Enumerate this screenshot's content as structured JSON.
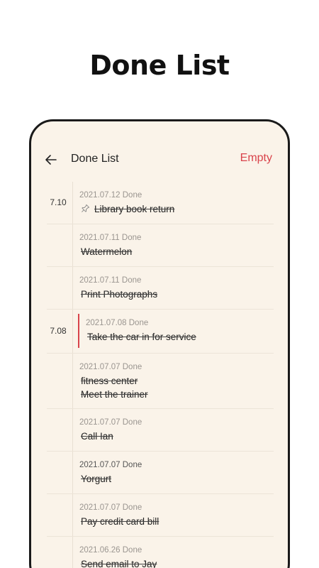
{
  "hero": {
    "title": "Done List"
  },
  "header": {
    "title": "Done List",
    "empty_label": "Empty"
  },
  "groups": [
    {
      "date": "7.10"
    },
    {
      "date": "7.08"
    }
  ],
  "items": [
    {
      "meta": "2021.07.12 Done",
      "title": "Library book return",
      "pinned": true
    },
    {
      "meta": "2021.07.11 Done",
      "title": "Watermelon"
    },
    {
      "meta": "2021.07.11 Done",
      "title": "Print Photographs"
    },
    {
      "meta": "2021.07.08 Done",
      "title": "Take the car in for service"
    },
    {
      "meta": "2021.07.07  Done",
      "title": "fitness center",
      "title2": "Meet the trainer"
    },
    {
      "meta": "2021.07.07 Done",
      "title": "Call Ian"
    },
    {
      "meta": "2021.07.07 Done",
      "title": "Yorgurt"
    },
    {
      "meta": "2021.07.07 Done",
      "title": "Pay credit card bill"
    },
    {
      "meta": "2021.06.26 Done",
      "title": "Send email to Jay"
    }
  ],
  "colors": {
    "accent": "#d9434b",
    "background": "#faf3e9"
  }
}
